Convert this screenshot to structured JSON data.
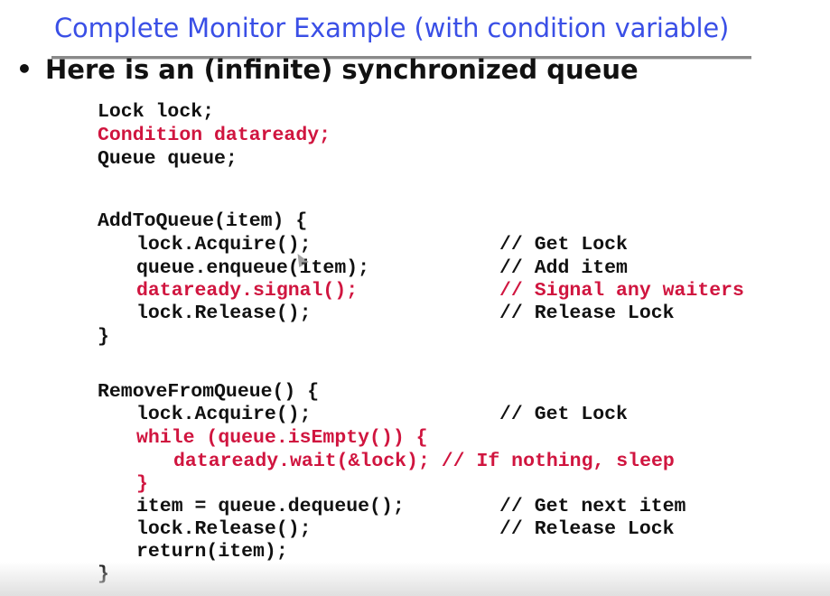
{
  "slide": {
    "title": "Complete Monitor Example (with condition variable)",
    "bullet_marker": "•",
    "bullet_text": "Here is an (infinite) synchronized queue"
  },
  "code": {
    "decl_lock": "Lock lock;",
    "decl_condition": "Condition dataready;",
    "decl_queue": "Queue queue;",
    "add_header": "AddToQueue(item) {",
    "add_acquire": "lock.Acquire();",
    "add_acquire_comment": "// Get Lock",
    "add_enqueue": "queue.enqueue(item);",
    "add_enqueue_comment": "// Add item",
    "add_signal": "dataready.signal();",
    "add_signal_comment": "// Signal any waiters",
    "add_release": "lock.Release();",
    "add_release_comment": "// Release Lock",
    "add_close": "}",
    "remove_header": "RemoveFromQueue() {",
    "remove_acquire": "lock.Acquire();",
    "remove_acquire_comment": "// Get Lock",
    "remove_while": "while (queue.isEmpty()) {",
    "remove_wait": "dataready.wait(&lock); // If nothing, sleep",
    "remove_while_close": "}",
    "remove_dequeue": "item = queue.dequeue();",
    "remove_dequeue_comment": "// Get next item",
    "remove_release": "lock.Release();",
    "remove_release_comment": "// Release Lock",
    "remove_return": "return(item);",
    "remove_close": "}"
  },
  "colors": {
    "title": "#3a4fe6",
    "highlight": "#d0153f",
    "text": "#111111"
  }
}
